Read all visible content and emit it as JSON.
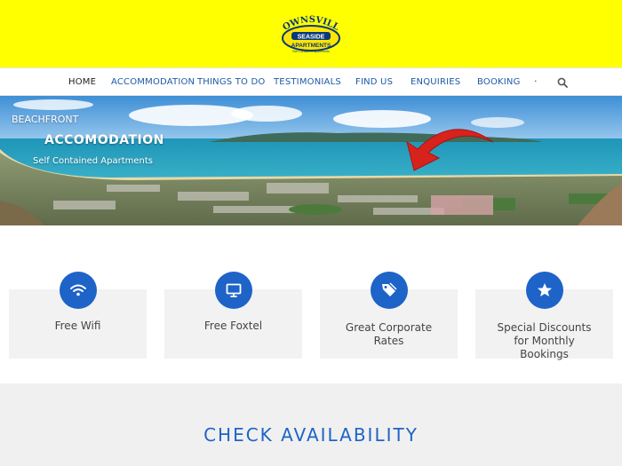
{
  "logo": {
    "line1": "TOWNSVILLE",
    "line2": "SEASIDE",
    "line3": "APARTMENTS",
    "line4": "Self Contained Apartments"
  },
  "nav": {
    "items": [
      {
        "label": "HOME",
        "active": true
      },
      {
        "label": "ACCOMMODATION"
      },
      {
        "label": "THINGS TO DO"
      },
      {
        "label": "TESTIMONIALS"
      },
      {
        "label": "FIND US"
      },
      {
        "label": "ENQUIRIES"
      },
      {
        "label": "BOOKING"
      }
    ],
    "separator": "·",
    "search_icon": "search-icon"
  },
  "hero": {
    "line1": "BEACHFRONT",
    "line2": "ACCOMODATION",
    "line3": "Self Contained Apartments"
  },
  "features": [
    {
      "icon": "wifi-icon",
      "label": "Free Wifi"
    },
    {
      "icon": "tv-icon",
      "label": "Free Foxtel"
    },
    {
      "icon": "tag-icon",
      "label": "Great Corporate Rates"
    },
    {
      "icon": "star-icon",
      "label": "Special Discounts for Monthly Bookings"
    }
  ],
  "availability": {
    "title": "CHECK AVAILABILITY"
  },
  "colors": {
    "header_bg": "#ffff00",
    "accent": "#1e63c7",
    "nav_link": "#1d5aa6",
    "arrow": "#d8231d"
  }
}
